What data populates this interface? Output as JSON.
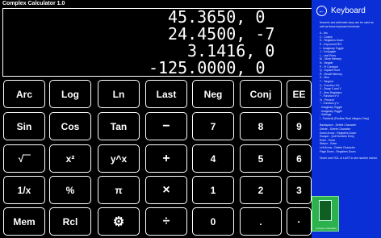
{
  "app": {
    "title": "Complex Calculator 1.0"
  },
  "display": {
    "lines": [
      "45.3650,  0",
      "24.4500,  -7",
      "3.1416,  0",
      "-125.0000,  0"
    ]
  },
  "keys": {
    "arc": "Arc",
    "log": "Log",
    "ln": "Ln",
    "last": "Last",
    "neg": "Neg",
    "conj": "Conj",
    "ee": "EE",
    "sin": "Sin",
    "cos": "Cos",
    "tan": "Tan",
    "minus": "−",
    "seven": "7",
    "eight": "8",
    "nine": "9",
    "sqrt": "√‾‾",
    "square": "x²",
    "ypowx": "y^x",
    "plus": "+",
    "four": "4",
    "five": "5",
    "six": "6",
    "recip": "1/x",
    "percent": "%",
    "pi": "π",
    "times": "×",
    "one": "1",
    "two": "2",
    "three": "3",
    "mem": "Mem",
    "rcl": "Rcl",
    "settings": "⚙",
    "divide": "÷",
    "zero": "0",
    "dot": ".",
    "enter": "·"
  },
  "panel": {
    "title": "Keyboard",
    "intro": "Numeric and arithmetic keys can be used as well as these keyboard shortcuts:",
    "shortcuts": "A - Arc\nC - Cosine\nD - Registers Down\nE - Exponent EEX\nI - Imaginary Toggle\nJ - Conjugate\nL - Last Entry\nM - Store Memory\nN - Negate\nP - Pi Constant\nQ - Square Root\nR - Recall Memory\nS - Sine\nT - Tangent\nU - Function 1/X\nX - Swap X and Y\nZ - Zero Registers\n^ - Function x^2\n% - Percent\n^ - Function y^x\n- Imaginary Toggle\n- Imaginary Toggle\n- Settings\n! - Factorial (Positive Real Integers Only)",
    "editing": "Backspace - Delete Character\nDelete - Delete Character\nDown Arrow - Registers Down\nEscape - Quit Numeric Entry\nEnter - Enter\nReturn - Enter\nLeft Arrow - Delete Character\nPage Down - Registers Down",
    "footer": "Hover over RCL or LAST to see number stored."
  },
  "store": {
    "label": "Complex Calculator"
  }
}
